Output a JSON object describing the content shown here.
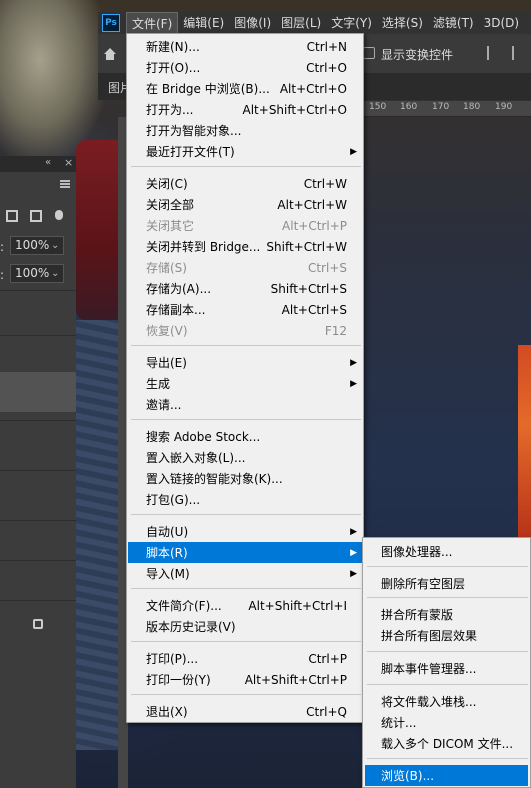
{
  "menubar": {
    "app_logo": "Ps",
    "items": [
      "文件(F)",
      "编辑(E)",
      "图像(I)",
      "图层(L)",
      "文字(Y)",
      "选择(S)",
      "滤镜(T)",
      "3D(D)"
    ]
  },
  "options": {
    "show_transform_label": "显示变换控件"
  },
  "tab": {
    "label": "图片"
  },
  "ruler": {
    "ticks": [
      "150",
      "160",
      "170",
      "180",
      "190"
    ]
  },
  "panel": {
    "collapse": "«",
    "close": "×",
    "opacity_value": "100%",
    "fill_value": "100%",
    "opacity_label": ":",
    "fill_label": ":"
  },
  "file_menu": {
    "items": [
      {
        "label": "新建(N)...",
        "shortcut": "Ctrl+N"
      },
      {
        "label": "打开(O)...",
        "shortcut": "Ctrl+O"
      },
      {
        "label": "在 Bridge 中浏览(B)...",
        "shortcut": "Alt+Ctrl+O"
      },
      {
        "label": "打开为...",
        "shortcut": "Alt+Shift+Ctrl+O"
      },
      {
        "label": "打开为智能对象...",
        "shortcut": ""
      },
      {
        "label": "最近打开文件(T)",
        "shortcut": "",
        "submenu": true
      },
      {
        "label": "关闭(C)",
        "shortcut": "Ctrl+W"
      },
      {
        "label": "关闭全部",
        "shortcut": "Alt+Ctrl+W"
      },
      {
        "label": "关闭其它",
        "shortcut": "Alt+Ctrl+P",
        "disabled": true
      },
      {
        "label": "关闭并转到 Bridge...",
        "shortcut": "Shift+Ctrl+W"
      },
      {
        "label": "存储(S)",
        "shortcut": "Ctrl+S",
        "disabled": true
      },
      {
        "label": "存储为(A)...",
        "shortcut": "Shift+Ctrl+S"
      },
      {
        "label": "存储副本...",
        "shortcut": "Alt+Ctrl+S"
      },
      {
        "label": "恢复(V)",
        "shortcut": "F12",
        "disabled": true
      },
      {
        "label": "导出(E)",
        "shortcut": "",
        "submenu": true
      },
      {
        "label": "生成",
        "shortcut": "",
        "submenu": true
      },
      {
        "label": "邀请...",
        "shortcut": ""
      },
      {
        "label": "搜索 Adobe Stock...",
        "shortcut": ""
      },
      {
        "label": "置入嵌入对象(L)...",
        "shortcut": ""
      },
      {
        "label": "置入链接的智能对象(K)...",
        "shortcut": ""
      },
      {
        "label": "打包(G)...",
        "shortcut": ""
      },
      {
        "label": "自动(U)",
        "shortcut": "",
        "submenu": true
      },
      {
        "label": "脚本(R)",
        "shortcut": "",
        "submenu": true,
        "active": true
      },
      {
        "label": "导入(M)",
        "shortcut": "",
        "submenu": true
      },
      {
        "label": "文件简介(F)...",
        "shortcut": "Alt+Shift+Ctrl+I"
      },
      {
        "label": "版本历史记录(V)",
        "shortcut": ""
      },
      {
        "label": "打印(P)...",
        "shortcut": "Ctrl+P"
      },
      {
        "label": "打印一份(Y)",
        "shortcut": "Alt+Shift+Ctrl+P"
      },
      {
        "label": "退出(X)",
        "shortcut": "Ctrl+Q"
      }
    ]
  },
  "scripts_menu": {
    "items": [
      {
        "label": "图像处理器..."
      },
      {
        "label": "删除所有空图层"
      },
      {
        "label": "拼合所有蒙版"
      },
      {
        "label": "拼合所有图层效果"
      },
      {
        "label": "脚本事件管理器..."
      },
      {
        "label": "将文件载入堆栈..."
      },
      {
        "label": "统计..."
      },
      {
        "label": "载入多个 DICOM 文件..."
      },
      {
        "label": "浏览(B)...",
        "active": true
      }
    ]
  },
  "colors": {
    "highlight": "#0078d7",
    "menu_bg": "#f0f0f0",
    "chrome": "#323232"
  }
}
